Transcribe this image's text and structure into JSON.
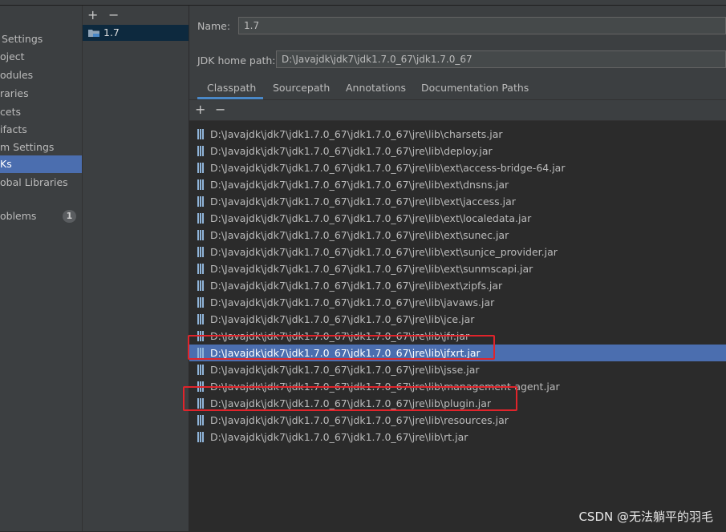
{
  "nav": {
    "items": [
      {
        "label": "Settings"
      },
      {
        "label": "oject"
      },
      {
        "label": "odules"
      },
      {
        "label": "raries"
      },
      {
        "label": "cets"
      },
      {
        "label": "ifacts"
      },
      {
        "label": "m Settings"
      },
      {
        "label": "Ks"
      },
      {
        "label": "obal Libraries"
      },
      {
        "label": "oblems",
        "badge": "1"
      }
    ]
  },
  "sdk_list": {
    "add_label": "+",
    "remove_label": "−",
    "items": [
      {
        "label": "1.7"
      }
    ]
  },
  "detail": {
    "name_label": "Name:",
    "name_value": "1.7",
    "home_label": "JDK home path:",
    "home_value": "D:\\Javajdk\\jdk7\\jdk1.7.0_67\\jdk1.7.0_67",
    "tabs": [
      {
        "label": "Classpath"
      },
      {
        "label": "Sourcepath"
      },
      {
        "label": "Annotations"
      },
      {
        "label": "Documentation Paths"
      }
    ],
    "add_label": "+",
    "remove_label": "−",
    "classpath": [
      "D:\\Javajdk\\jdk7\\jdk1.7.0_67\\jdk1.7.0_67\\jre\\lib\\charsets.jar",
      "D:\\Javajdk\\jdk7\\jdk1.7.0_67\\jdk1.7.0_67\\jre\\lib\\deploy.jar",
      "D:\\Javajdk\\jdk7\\jdk1.7.0_67\\jdk1.7.0_67\\jre\\lib\\ext\\access-bridge-64.jar",
      "D:\\Javajdk\\jdk7\\jdk1.7.0_67\\jdk1.7.0_67\\jre\\lib\\ext\\dnsns.jar",
      "D:\\Javajdk\\jdk7\\jdk1.7.0_67\\jdk1.7.0_67\\jre\\lib\\ext\\jaccess.jar",
      "D:\\Javajdk\\jdk7\\jdk1.7.0_67\\jdk1.7.0_67\\jre\\lib\\ext\\localedata.jar",
      "D:\\Javajdk\\jdk7\\jdk1.7.0_67\\jdk1.7.0_67\\jre\\lib\\ext\\sunec.jar",
      "D:\\Javajdk\\jdk7\\jdk1.7.0_67\\jdk1.7.0_67\\jre\\lib\\ext\\sunjce_provider.jar",
      "D:\\Javajdk\\jdk7\\jdk1.7.0_67\\jdk1.7.0_67\\jre\\lib\\ext\\sunmscapi.jar",
      "D:\\Javajdk\\jdk7\\jdk1.7.0_67\\jdk1.7.0_67\\jre\\lib\\ext\\zipfs.jar",
      "D:\\Javajdk\\jdk7\\jdk1.7.0_67\\jdk1.7.0_67\\jre\\lib\\javaws.jar",
      "D:\\Javajdk\\jdk7\\jdk1.7.0_67\\jdk1.7.0_67\\jre\\lib\\jce.jar",
      "D:\\Javajdk\\jdk7\\jdk1.7.0_67\\jdk1.7.0_67\\jre\\lib\\jfr.jar",
      "D:\\Javajdk\\jdk7\\jdk1.7.0_67\\jdk1.7.0_67\\jre\\lib\\jfxrt.jar",
      "D:\\Javajdk\\jdk7\\jdk1.7.0_67\\jdk1.7.0_67\\jre\\lib\\jsse.jar",
      "D:\\Javajdk\\jdk7\\jdk1.7.0_67\\jdk1.7.0_67\\jre\\lib\\management-agent.jar",
      "D:\\Javajdk\\jdk7\\jdk1.7.0_67\\jdk1.7.0_67\\jre\\lib\\plugin.jar",
      "D:\\Javajdk\\jdk7\\jdk1.7.0_67\\jdk1.7.0_67\\jre\\lib\\resources.jar",
      "D:\\Javajdk\\jdk7\\jdk1.7.0_67\\jdk1.7.0_67\\jre\\lib\\rt.jar"
    ]
  },
  "watermark": "CSDN @无法躺平的羽毛",
  "colors": {
    "selection": "#4b6eaf",
    "highlight_box": "#e0242b",
    "tab_underline": "#4a88c7"
  }
}
